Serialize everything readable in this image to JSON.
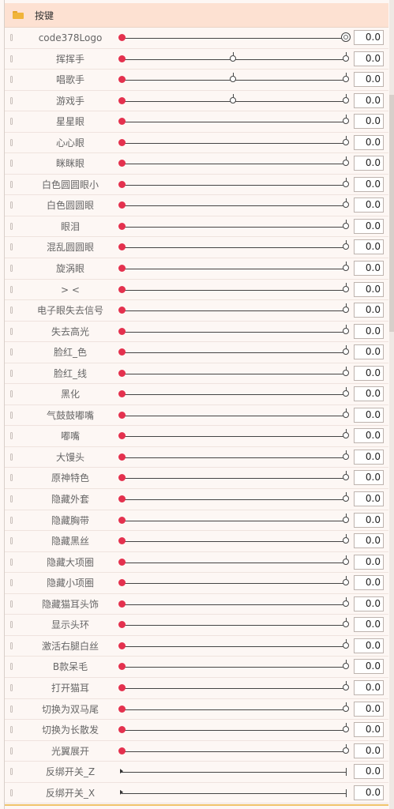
{
  "header": {
    "title": "按键",
    "icon": "folder-icon"
  },
  "rows": [
    {
      "label": "code378Logo",
      "value": "0.0",
      "knobs": [
        "end-focused"
      ]
    },
    {
      "label": "挥挥手",
      "value": "0.0",
      "knobs": [
        "mid",
        "end"
      ]
    },
    {
      "label": "唱歌手",
      "value": "0.0",
      "knobs": [
        "mid",
        "end"
      ]
    },
    {
      "label": "游戏手",
      "value": "0.0",
      "knobs": [
        "mid",
        "end"
      ]
    },
    {
      "label": "星星眼",
      "value": "0.0",
      "knobs": [
        "end"
      ]
    },
    {
      "label": "心心眼",
      "value": "0.0",
      "knobs": [
        "end"
      ]
    },
    {
      "label": "眯眯眼",
      "value": "0.0",
      "knobs": [
        "end"
      ]
    },
    {
      "label": "白色圆圆眼小",
      "value": "0.0",
      "knobs": [
        "end"
      ]
    },
    {
      "label": "白色圆圆眼",
      "value": "0.0",
      "knobs": [
        "end"
      ]
    },
    {
      "label": "眼泪",
      "value": "0.0",
      "knobs": [
        "end"
      ]
    },
    {
      "label": "混乱圆圆眼",
      "value": "0.0",
      "knobs": [
        "end"
      ]
    },
    {
      "label": "旋涡眼",
      "value": "0.0",
      "knobs": [
        "end"
      ]
    },
    {
      "label": "> <",
      "value": "0.0",
      "knobs": [
        "end"
      ]
    },
    {
      "label": "电子眼失去信号",
      "value": "0.0",
      "knobs": [
        "end"
      ]
    },
    {
      "label": "失去高光",
      "value": "0.0",
      "knobs": [
        "end"
      ]
    },
    {
      "label": "脸红_色",
      "value": "0.0",
      "knobs": [
        "end"
      ]
    },
    {
      "label": "脸红_线",
      "value": "0.0",
      "knobs": [
        "end"
      ]
    },
    {
      "label": "黑化",
      "value": "0.0",
      "knobs": [
        "end"
      ]
    },
    {
      "label": "气鼓鼓嘟嘴",
      "value": "0.0",
      "knobs": [
        "end"
      ]
    },
    {
      "label": "嘟嘴",
      "value": "0.0",
      "knobs": [
        "end"
      ]
    },
    {
      "label": "大馒头",
      "value": "0.0",
      "knobs": [
        "end"
      ]
    },
    {
      "label": "原神特色",
      "value": "0.0",
      "knobs": [
        "end"
      ]
    },
    {
      "label": "隐藏外套",
      "value": "0.0",
      "knobs": [
        "end"
      ]
    },
    {
      "label": "隐藏胸带",
      "value": "0.0",
      "knobs": [
        "end"
      ]
    },
    {
      "label": "隐藏黑丝",
      "value": "0.0",
      "knobs": [
        "end"
      ]
    },
    {
      "label": "隐藏大项圈",
      "value": "0.0",
      "knobs": [
        "end"
      ]
    },
    {
      "label": "隐藏小项圈",
      "value": "0.0",
      "knobs": [
        "end"
      ]
    },
    {
      "label": "隐藏猫耳头饰",
      "value": "0.0",
      "knobs": [
        "end"
      ]
    },
    {
      "label": "显示头环",
      "value": "0.0",
      "knobs": [
        "end"
      ]
    },
    {
      "label": "激活右腿白丝",
      "value": "0.0",
      "knobs": [
        "end"
      ]
    },
    {
      "label": "B款呆毛",
      "value": "0.0",
      "knobs": [
        "end"
      ]
    },
    {
      "label": "打开猫耳",
      "value": "0.0",
      "knobs": [
        "end"
      ]
    },
    {
      "label": "切换为双马尾",
      "value": "0.0",
      "knobs": [
        "end"
      ]
    },
    {
      "label": "切换为长散发",
      "value": "0.0",
      "knobs": [
        "end"
      ]
    },
    {
      "label": "光翼展开",
      "value": "0.0",
      "knobs": [
        "end"
      ]
    },
    {
      "label": "反绑开关_Z",
      "value": "0.0",
      "knobs": [
        "tick"
      ]
    },
    {
      "label": "反绑开关_X",
      "value": "0.0",
      "knobs": [
        "tick"
      ]
    }
  ]
}
